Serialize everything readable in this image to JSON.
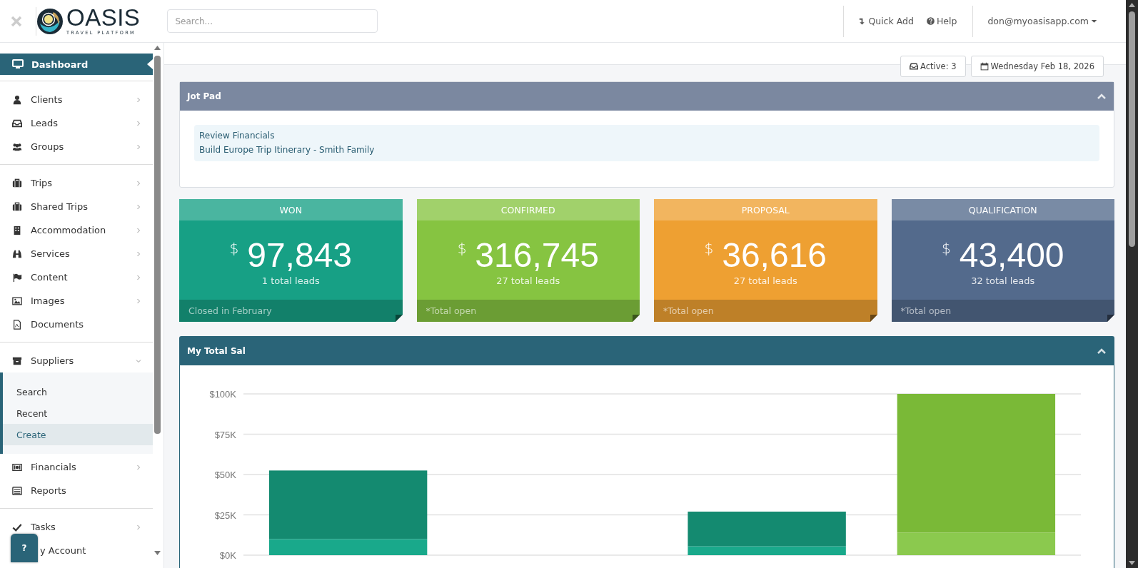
{
  "header": {
    "logo": {
      "name": "OASIS",
      "tagline": "TRAVEL PLATFORM"
    },
    "search": {
      "placeholder": "Search..."
    },
    "quick_add": "Quick Add",
    "help": "Help",
    "user": "don@myoasisapp.com"
  },
  "sidebar": {
    "sections": [
      [
        {
          "label": "Dashboard",
          "selected": true
        }
      ],
      [
        {
          "label": "Clients",
          "selected": false,
          "expanded": false
        },
        {
          "label": "Leads",
          "selected": false,
          "expanded": false
        },
        {
          "label": "Groups",
          "selected": false,
          "expanded": false
        }
      ],
      [
        {
          "label": "Trips",
          "selected": false,
          "expanded": false
        },
        {
          "label": "Shared Trips",
          "selected": false,
          "expanded": false
        },
        {
          "label": "Accommodation",
          "selected": false,
          "expanded": false
        },
        {
          "label": "Services",
          "selected": false,
          "expanded": false
        },
        {
          "label": "Content",
          "selected": false,
          "expanded": false
        },
        {
          "label": "Images",
          "selected": false,
          "expanded": false
        },
        {
          "label": "Documents",
          "selected": false
        }
      ],
      [
        {
          "label": "Suppliers",
          "selected": false,
          "expanded": true,
          "children": [
            {
              "label": "Search",
              "selected": false
            },
            {
              "label": "Recent",
              "selected": false
            },
            {
              "label": "Create",
              "selected": true
            }
          ]
        },
        {
          "label": "Financials",
          "selected": false,
          "expanded": false
        },
        {
          "label": "Reports",
          "selected": false
        }
      ],
      [
        {
          "label": "Tasks",
          "selected": false,
          "expanded": false
        },
        {
          "label": "y Account",
          "selected": false
        }
      ]
    ],
    "help_button": "?"
  },
  "toolbar": {
    "active": "Active: 3",
    "date": "Wednesday Feb 18, 2026"
  },
  "jot_pad": {
    "title": "Jot Pad",
    "items": [
      "Review Financials",
      "Build Europe Trip Itinerary - Smith Family"
    ]
  },
  "cards": [
    {
      "title": "WON",
      "currency": "$",
      "amount": "97,843",
      "leads": "1 total leads",
      "footer": "Closed in February",
      "color": "#17a085"
    },
    {
      "title": "CONFIRMED",
      "currency": "$",
      "amount": "316,745",
      "leads": "27 total leads",
      "footer": "*Total open",
      "color": "#86c441"
    },
    {
      "title": "PROPOSAL",
      "currency": "$",
      "amount": "36,616",
      "leads": "27 total leads",
      "footer": "*Total open",
      "color": "#eea032"
    },
    {
      "title": "QUALIFICATION",
      "currency": "$",
      "amount": "43,400",
      "leads": "32 total leads",
      "footer": "*Total open",
      "color": "#536a8c"
    }
  ],
  "sales": {
    "title": "My Total Sal",
    "chart_data": {
      "type": "bar",
      "stacked": true,
      "grid": true,
      "ylim": [
        0,
        100
      ],
      "yticks": [
        {
          "value": 0,
          "label": "$0K"
        },
        {
          "value": 25,
          "label": "$25K"
        },
        {
          "value": 50,
          "label": "$50K"
        },
        {
          "value": 75,
          "label": "$75K"
        },
        {
          "value": 100,
          "label": "$100K"
        }
      ],
      "series": [
        {
          "color": "#19a98b",
          "values": [
            10,
            null,
            5.5,
            null
          ]
        },
        {
          "color": "#148a70",
          "values": [
            42.5,
            null,
            21.5,
            null
          ]
        },
        {
          "color": "#8bc94e",
          "values": [
            null,
            null,
            null,
            14
          ]
        },
        {
          "color": "#7ab937",
          "values": [
            null,
            null,
            null,
            86
          ]
        }
      ]
    }
  }
}
